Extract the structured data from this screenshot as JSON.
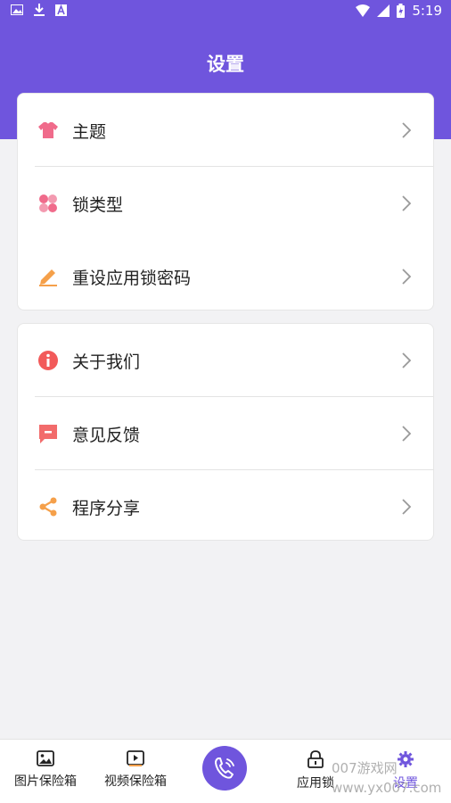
{
  "status_bar": {
    "time": "5:19"
  },
  "header": {
    "title": "设置"
  },
  "group1": [
    {
      "label": "主题",
      "icon": "shirt-icon"
    },
    {
      "label": "锁类型",
      "icon": "petals-icon"
    },
    {
      "label": "重设应用锁密码",
      "icon": "pencil-icon"
    }
  ],
  "group2": [
    {
      "label": "关于我们",
      "icon": "info-icon"
    },
    {
      "label": "意见反馈",
      "icon": "feedback-icon"
    },
    {
      "label": "程序分享",
      "icon": "share-icon"
    }
  ],
  "tabs": [
    {
      "label": "图片保险箱",
      "icon": "image-icon"
    },
    {
      "label": "视频保险箱",
      "icon": "video-icon"
    },
    {
      "label": "应用锁",
      "icon": "lock-icon"
    },
    {
      "label": "设置",
      "icon": "gear-icon"
    }
  ],
  "watermark": "007游戏网 www.yx007.com",
  "colors": {
    "primary": "#6f55dd",
    "pink": "#f06b8b",
    "orange": "#f5a04a",
    "red": "#f25a5a"
  }
}
